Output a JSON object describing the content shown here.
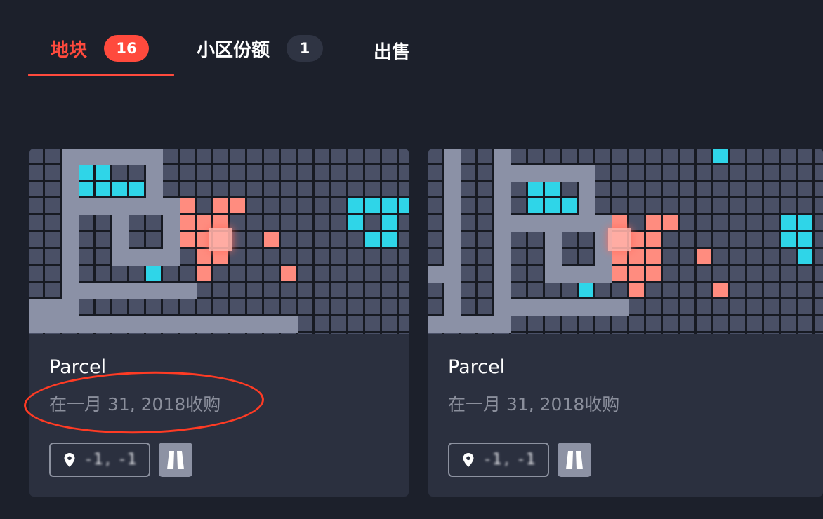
{
  "tabs": [
    {
      "label": "地块",
      "badge": "16",
      "active": true
    },
    {
      "label": "小区份额",
      "badge": "1",
      "active": false
    },
    {
      "label": "出售",
      "badge": null,
      "active": false
    }
  ],
  "cards": [
    {
      "title": "Parcel",
      "date": "在一月 31, 2018收购",
      "coords": "-1, -1",
      "icons": [
        "location-pin-icon",
        "road-icon"
      ]
    },
    {
      "title": "Parcel",
      "date": "在一月 31, 2018收购",
      "coords": "-1, -1",
      "icons": [
        "location-pin-icon",
        "road-icon"
      ]
    }
  ],
  "colors": {
    "accent": "#ff4a3d",
    "background": "#1c202b",
    "card": "#2b303f",
    "map_parcel": "#4a5066",
    "map_road": "#8b91a6",
    "map_district": "#2fd5e8",
    "map_owned": "#ff8c7f"
  },
  "annotation": {
    "shape": "ellipse",
    "color": "#ff3b24"
  }
}
